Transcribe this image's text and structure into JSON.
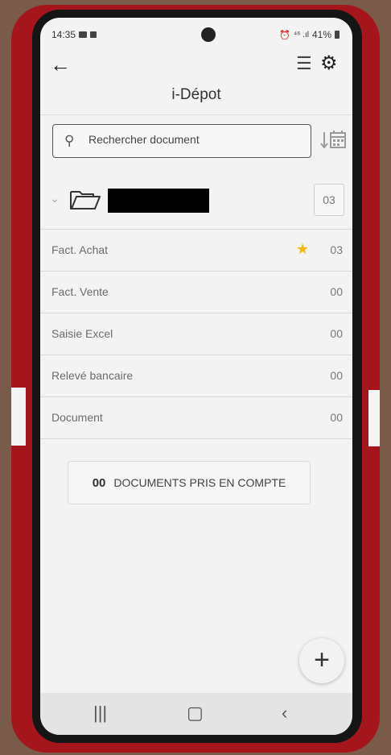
{
  "status_bar": {
    "time": "14:35",
    "signal": "⁴⁶ .ıl",
    "battery": "41%"
  },
  "header": {
    "title": "i-Dépot"
  },
  "search": {
    "placeholder": "Rechercher document"
  },
  "folder": {
    "count": "03"
  },
  "rows": [
    {
      "label": "Fact. Achat",
      "count": "03",
      "starred": true
    },
    {
      "label": "Fact. Vente",
      "count": "00"
    },
    {
      "label": "Saisie Excel",
      "count": "00"
    },
    {
      "label": "Relevé bancaire",
      "count": "00"
    },
    {
      "label": "Document",
      "count": "00"
    }
  ],
  "summary": {
    "count": "00",
    "label": "DOCUMENTS PRIS EN COMPTE"
  },
  "icons": {
    "back": "arrow-left",
    "list": "list",
    "settings": "gear",
    "search": "magnifier",
    "sort": "sort-by-date",
    "folder": "open-folder",
    "star": "star",
    "add": "plus"
  },
  "colors": {
    "star": "#f5b700",
    "case": "#a5161c"
  }
}
